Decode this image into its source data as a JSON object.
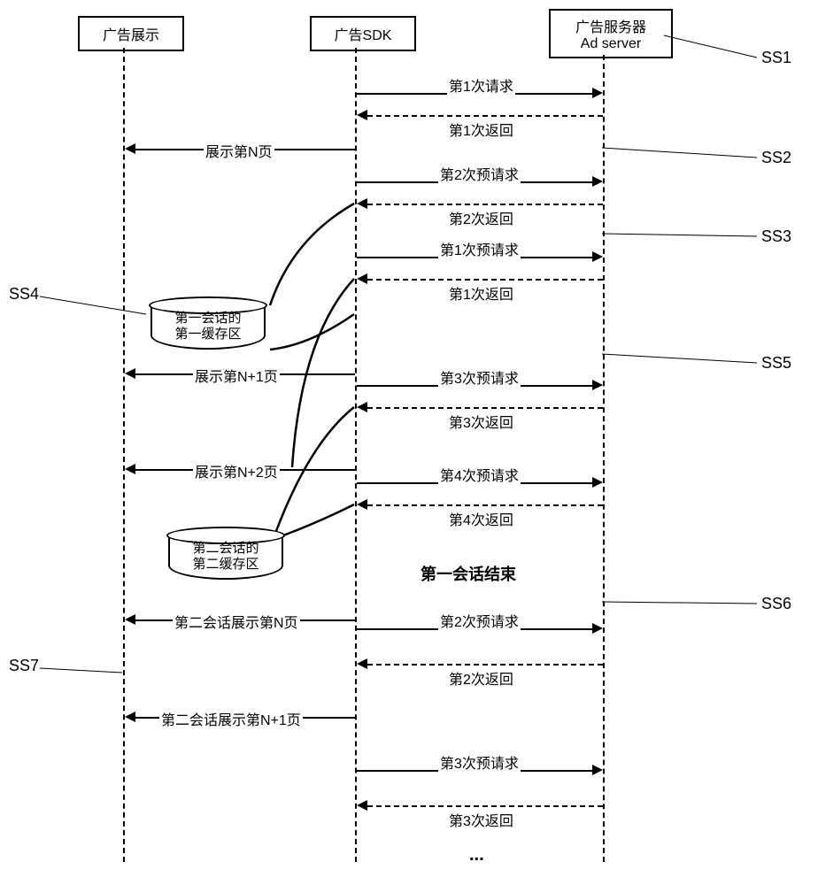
{
  "participants": {
    "display": "广告展示",
    "sdk": "广告SDK",
    "server_line1": "广告服务器",
    "server_line2": "Ad server"
  },
  "messages": {
    "req1": "第1次请求",
    "ret1": "第1次返回",
    "showN": "展示第N页",
    "preq2": "第2次预请求",
    "ret2": "第2次返回",
    "preq1": "第1次预请求",
    "ret1b": "第1次返回",
    "showN1": "展示第N+1页",
    "preq3": "第3次预请求",
    "ret3": "第3次返回",
    "showN2": "展示第N+2页",
    "preq4": "第4次预请求",
    "ret4": "第4次返回",
    "end1": "第一会话结束",
    "s2showN": "第二会话展示第N页",
    "s2preq2": "第2次预请求",
    "s2ret2": "第2次返回",
    "s2showN1": "第二会话展示第N+1页",
    "s2preq3": "第3次预请求",
    "s2ret3": "第3次返回",
    "ellipsis": "..."
  },
  "cache": {
    "c1_line1": "第一会话的",
    "c1_line2": "第一缓存区",
    "c2_line1": "第二会话的",
    "c2_line2": "第二缓存区"
  },
  "ss": {
    "ss1": "SS1",
    "ss2": "SS2",
    "ss3": "SS3",
    "ss4": "SS4",
    "ss5": "SS5",
    "ss6": "SS6",
    "ss7": "SS7"
  }
}
